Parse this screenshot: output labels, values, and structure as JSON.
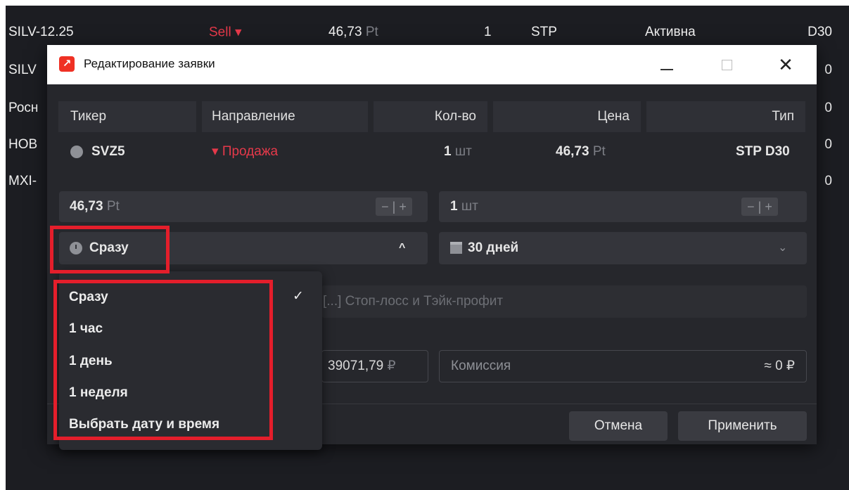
{
  "orders": [
    {
      "ticker": "SILV-12.25",
      "direction": "Sell ▾",
      "price": "46,73",
      "price_unit": "Pt",
      "qty": "1",
      "type": "STP",
      "status": "Активна",
      "expiry": "D30"
    },
    {
      "ticker": "SILV",
      "expiry": "0"
    },
    {
      "ticker": "Росн",
      "expiry": "0"
    },
    {
      "ticker": "НОВ",
      "expiry": "0"
    },
    {
      "ticker": "MXI-",
      "expiry": "0"
    }
  ],
  "dialog": {
    "title": "Редактирование заявки",
    "logo": "↗",
    "window_controls": {
      "close": "✕"
    },
    "columns": {
      "ticker": "Тикер",
      "direction": "Направление",
      "qty": "Кол-во",
      "price": "Цена",
      "type": "Тип"
    },
    "row": {
      "ticker_icon": "coin-icon",
      "ticker": "SVZ5",
      "direction": "▾ Продажа",
      "qty": "1",
      "qty_unit": "шт",
      "price": "46,73",
      "price_unit": "Pt",
      "type": "STP D30"
    },
    "price_input": {
      "value": "46,73",
      "unit": "Pt",
      "stepper": "− | +"
    },
    "qty_input": {
      "value": "1",
      "unit": "шт",
      "stepper": "− | +"
    },
    "activation_select": {
      "value": "Сразу",
      "chevron": "^"
    },
    "expiry_select": {
      "value": "30 дней",
      "chevron": "⌄"
    },
    "sltp_label": "[...] Стоп-лосс и Тэйк-профит",
    "amount": {
      "value": "39071,79",
      "unit": "₽"
    },
    "commission": {
      "label": "Комиссия",
      "value": "≈ 0 ₽"
    },
    "buttons": {
      "cancel": "Отмена",
      "apply": "Применить"
    }
  },
  "dropdown": {
    "options": [
      "Сразу",
      "1 час",
      "1 день",
      "1 неделя",
      "Выбрать дату и время"
    ],
    "selected_check": "✓"
  },
  "colors": {
    "sell": "#e5394a",
    "highlight": "#e41e2b",
    "background": "#1c1d22",
    "dialog": "#26272c"
  }
}
